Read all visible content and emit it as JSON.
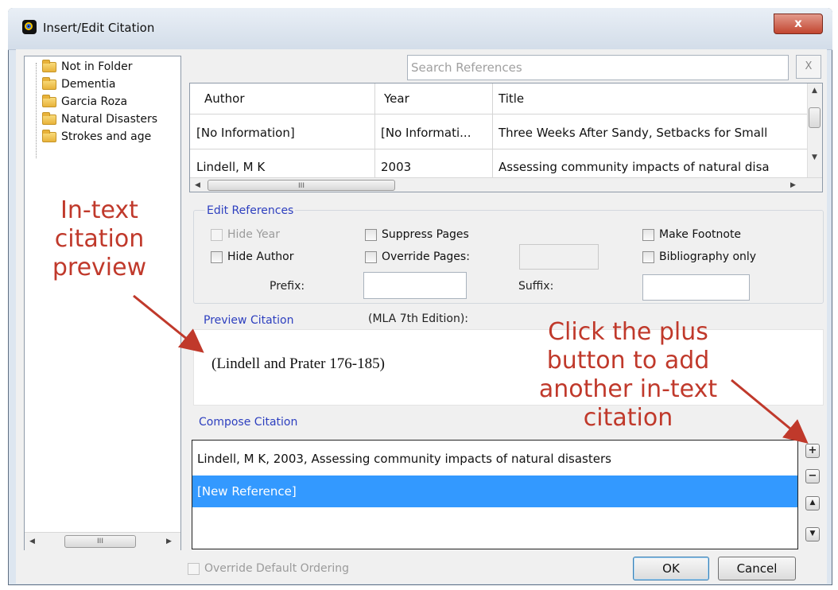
{
  "window": {
    "title": "Insert/Edit Citation",
    "close_label": "x"
  },
  "folders": {
    "items": [
      {
        "label": "Not in Folder"
      },
      {
        "label": "Dementia"
      },
      {
        "label": "Garcia Roza"
      },
      {
        "label": "Natural Disasters"
      },
      {
        "label": "Strokes and age"
      }
    ],
    "scroll_thumb": "III"
  },
  "search": {
    "placeholder": "Search References",
    "clear_label": "X"
  },
  "references": {
    "columns": [
      "Author",
      "Year",
      "Title"
    ],
    "rows": [
      {
        "author": "[No Information]",
        "year": "[No Informati...",
        "title": "Three Weeks After Sandy, Setbacks for Small"
      },
      {
        "author": "Lindell, M K",
        "year": "2003",
        "title": "Assessing community impacts of natural disa"
      }
    ],
    "scroll_thumb": "III"
  },
  "edit_references": {
    "label": "Edit References",
    "hide_year": "Hide Year",
    "hide_author": "Hide Author",
    "suppress_pages": "Suppress Pages",
    "override_pages": "Override Pages:",
    "make_footnote": "Make Footnote",
    "bibliography_only": "Bibliography only",
    "prefix_label": "Prefix:",
    "suffix_label": "Suffix:"
  },
  "preview": {
    "label": "Preview Citation",
    "style": "(MLA 7th Edition):",
    "text": "(Lindell and Prater 176-185)"
  },
  "compose": {
    "label": "Compose Citation",
    "items": [
      {
        "text": "Lindell, M K, 2003, Assessing community impacts of natural disasters",
        "selected": false
      },
      {
        "text": "[New Reference]",
        "selected": true
      }
    ],
    "buttons": {
      "add": "+",
      "remove": "−",
      "up": "▲",
      "down": "▼"
    }
  },
  "footer": {
    "override_ordering": "Override Default Ordering",
    "ok_label": "OK",
    "cancel_label": "Cancel"
  },
  "annotations": {
    "left_line1": "In-text",
    "left_line2": "citation",
    "left_line3": "preview",
    "right_line1": "Click the plus",
    "right_line2": "button to add",
    "right_line3": "another in-text",
    "right_line4": "citation",
    "color": "#c0392b"
  },
  "colors": {
    "selection": "#3399ff",
    "section_label": "#2d3fbf"
  }
}
